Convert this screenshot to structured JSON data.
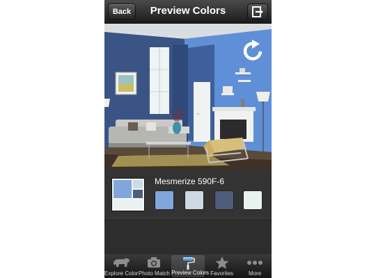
{
  "navbar": {
    "back_label": "Back",
    "title": "Preview Colors",
    "exit_icon": "exit-icon"
  },
  "preview": {
    "refresh_icon": "refresh-icon"
  },
  "color": {
    "name": "Mesmerize 590F-6",
    "swatches": [
      {
        "color": "#80a6dc"
      },
      {
        "color": "#ced9e6"
      },
      {
        "color": "#4f5d7c"
      },
      {
        "color": "#eaf2f1"
      }
    ]
  },
  "tabs": [
    {
      "label": "Explore Color",
      "icon": "bear-icon"
    },
    {
      "label": "Photo Match",
      "icon": "camera-icon"
    },
    {
      "label": "Preview Colors",
      "icon": "paint-roller-icon",
      "active": true
    },
    {
      "label": "Favorites",
      "icon": "star-icon"
    },
    {
      "label": "More",
      "icon": "more-dots-icon"
    }
  ]
}
